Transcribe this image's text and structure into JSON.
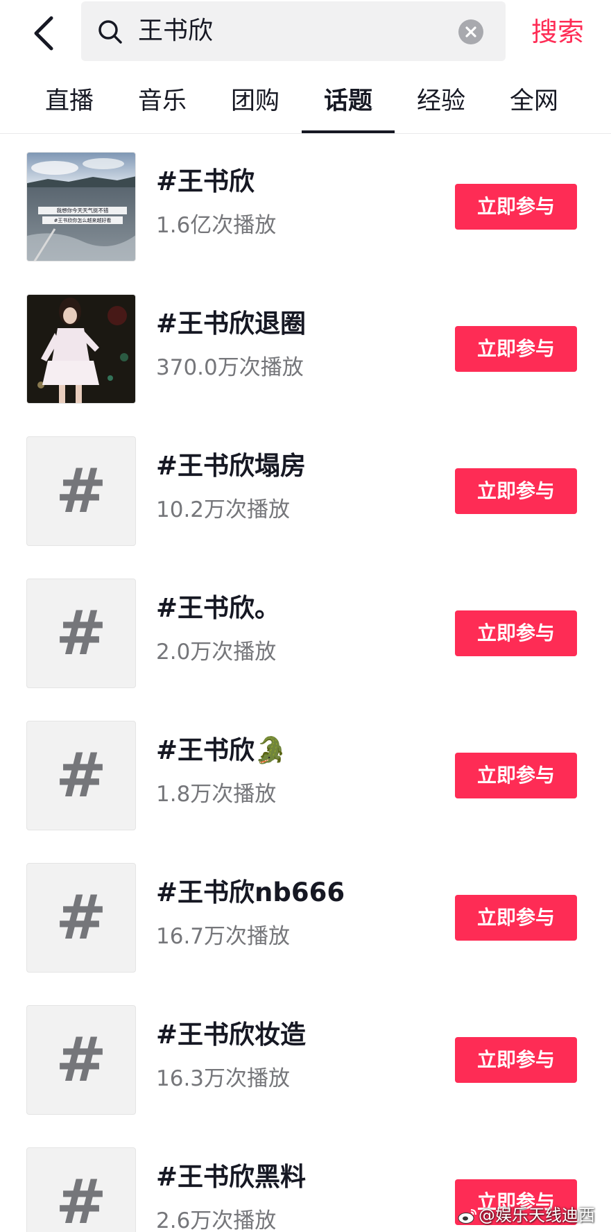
{
  "header": {
    "back_icon": "chevron-left-icon",
    "search": {
      "query": "王书欣",
      "icon": "search-icon",
      "clear_icon": "clear-icon"
    },
    "search_button": "搜索"
  },
  "tabs": [
    {
      "label": "直播",
      "active": false
    },
    {
      "label": "音乐",
      "active": false
    },
    {
      "label": "团购",
      "active": false
    },
    {
      "label": "话题",
      "active": true
    },
    {
      "label": "经验",
      "active": false
    },
    {
      "label": "全网",
      "active": false
    }
  ],
  "topics": [
    {
      "title": "#王书欣",
      "views": "1.6亿次播放",
      "thumb": "photo-lake",
      "thumb_caption": [
        "我想你今天天气挺不错",
        "#王书欣你怎么越来越好看"
      ],
      "action": "立即参与"
    },
    {
      "title": "#王书欣退圈",
      "views": "370.0万次播放",
      "thumb": "photo-performer",
      "action": "立即参与"
    },
    {
      "title": "#王书欣塌房",
      "views": "10.2万次播放",
      "thumb": "#",
      "action": "立即参与"
    },
    {
      "title": "#王书欣。",
      "views": "2.0万次播放",
      "thumb": "#",
      "action": "立即参与"
    },
    {
      "title": "#王书欣🐊",
      "views": "1.8万次播放",
      "thumb": "#",
      "action": "立即参与"
    },
    {
      "title": "#王书欣nb666",
      "views": "16.7万次播放",
      "thumb": "#",
      "action": "立即参与"
    },
    {
      "title": "#王书欣妆造",
      "views": "16.3万次播放",
      "thumb": "#",
      "action": "立即参与"
    },
    {
      "title": "#王书欣黑料",
      "views": "2.6万次播放",
      "thumb": "#",
      "action": "立即参与"
    }
  ],
  "watermark": {
    "text": "@娱乐天线迪西",
    "icon": "weibo-icon"
  },
  "colors": {
    "accent": "#fe2c55",
    "text_primary": "#161823",
    "text_secondary": "#75767a",
    "search_bg": "#f1f1f2",
    "thumb_bg": "#f2f2f2"
  }
}
